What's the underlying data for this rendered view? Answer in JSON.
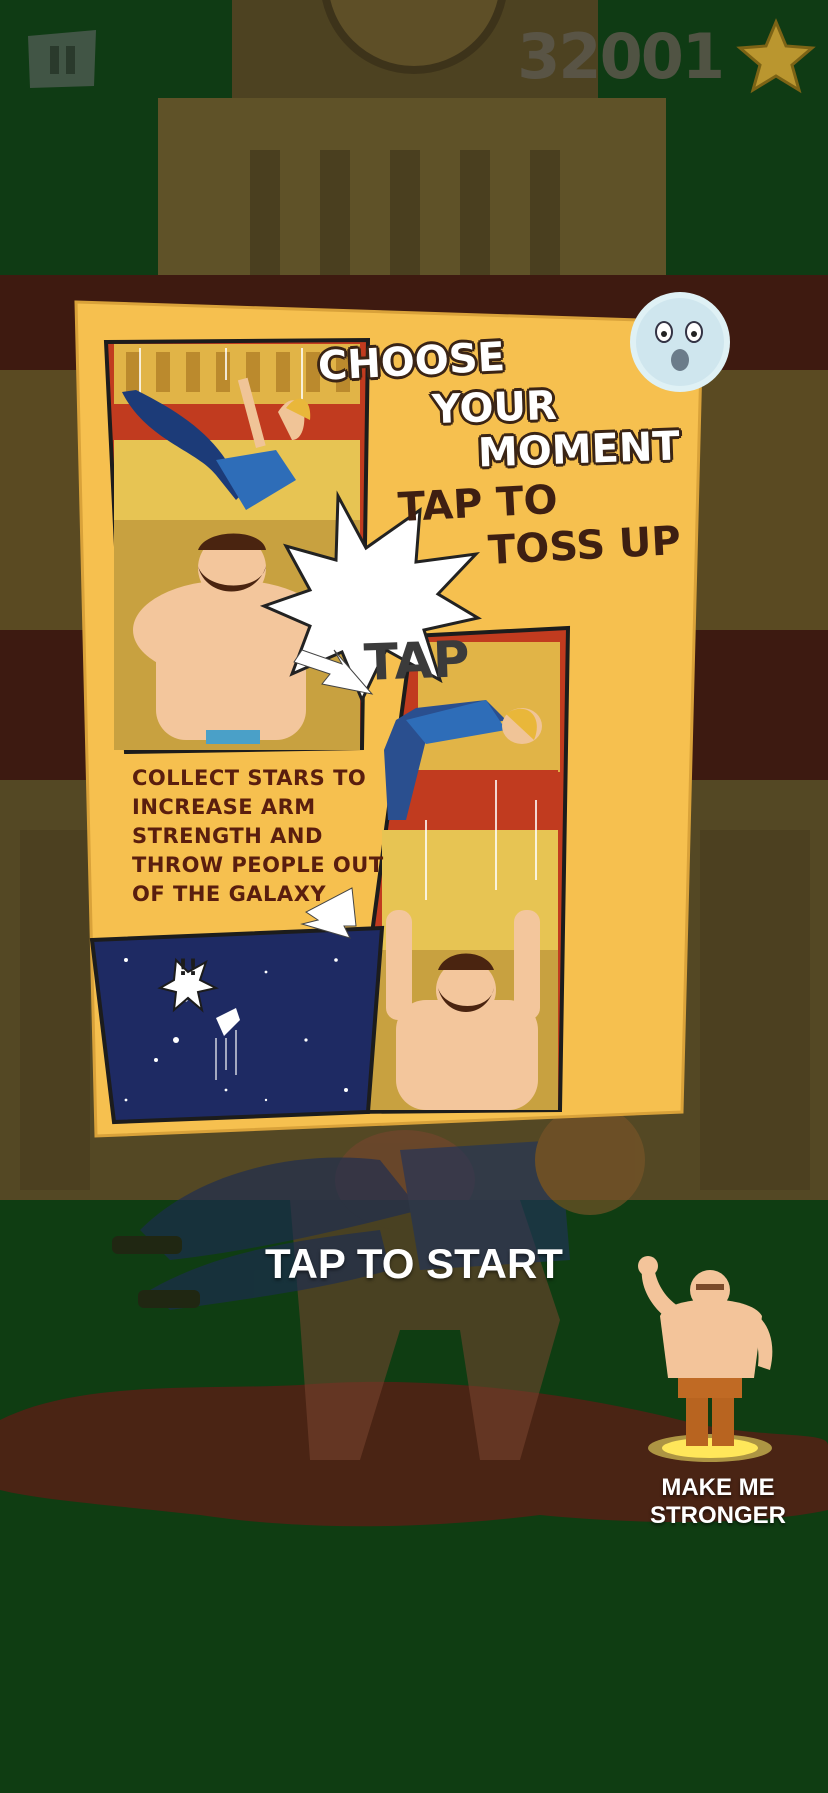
{
  "hud": {
    "score": "32001",
    "pause_icon": "pause-icon",
    "score_icon": "star-icon"
  },
  "tutorial": {
    "heading_lines": [
      "CHOOSE",
      "YOUR",
      "MOMENT"
    ],
    "instruction_lines": [
      "TAP TO",
      "TOSS UP"
    ],
    "tap_burst": "TAP",
    "collect_text": "COLLECT STARS TO INCREASE ARM STRENGTH AND THROW PEOPLE OUT OF THE GALAXY",
    "alert_burst": "!!",
    "moon_icon": "moon-face-icon"
  },
  "start_prompt": "TAP TO START",
  "upgrade": {
    "label": "MAKE ME STRONGER",
    "icon": "strongman-icon"
  },
  "colors": {
    "card": "#f6c04f",
    "grass": "#0f3d12",
    "dirt": "#4a2414",
    "score_text": "#5c584c",
    "star": "#e7b23a"
  }
}
